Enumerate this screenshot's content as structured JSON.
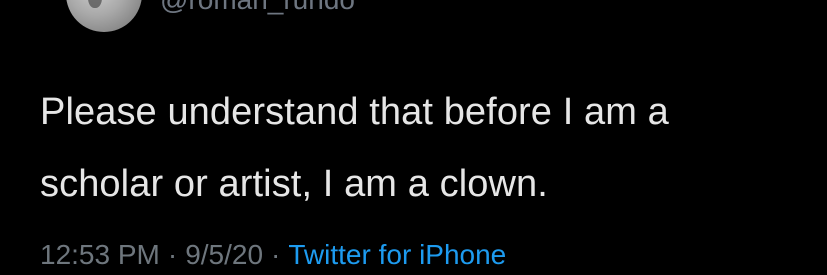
{
  "profile": {
    "handle": "@roman_rundo"
  },
  "tweet": {
    "text_line1": "Please understand that before I am a",
    "text_line2": "scholar or artist, I am a clown.",
    "time": "12:53 PM",
    "date": "9/5/20",
    "separator": "·",
    "source": "Twitter for iPhone"
  },
  "colors": {
    "background": "#000000",
    "text": "#e6e6e6",
    "meta": "#6e767d",
    "link": "#1d9bf0"
  }
}
